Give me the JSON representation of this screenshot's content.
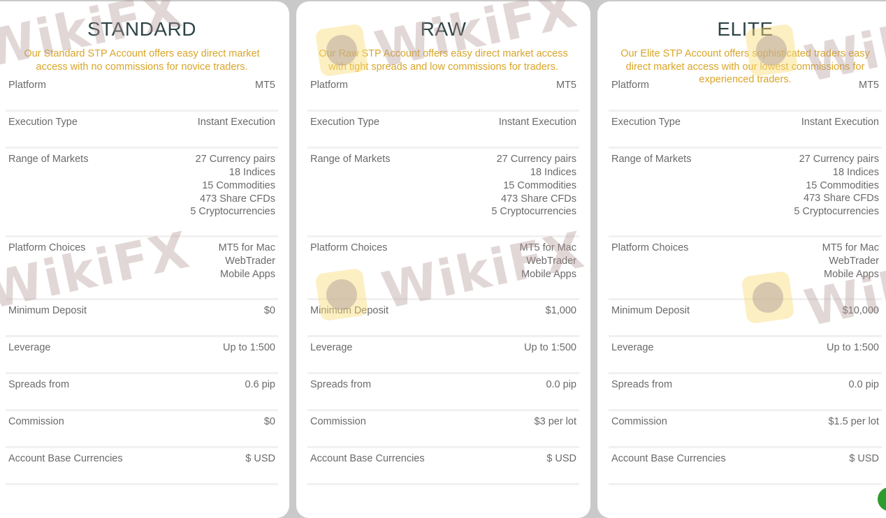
{
  "cards": [
    {
      "title": "STANDARD",
      "description": "Our Standard STP Account offers easy direct market access with no commissions for novice traders.",
      "rows": [
        {
          "label": "Platform",
          "values": [
            "MT5"
          ]
        },
        {
          "label": "Execution Type",
          "values": [
            "Instant Execution"
          ]
        },
        {
          "label": "Range of Markets",
          "values": [
            "27 Currency pairs",
            "18 Indices",
            "15 Commodities",
            "473 Share CFDs",
            "5 Cryptocurrencies"
          ]
        },
        {
          "label": "Platform Choices",
          "values": [
            "MT5 for Mac",
            "WebTrader",
            "Mobile Apps"
          ]
        },
        {
          "label": "Minimum Deposit",
          "values": [
            "$0"
          ]
        },
        {
          "label": "Leverage",
          "values": [
            "Up to 1:500"
          ]
        },
        {
          "label": "Spreads from",
          "values": [
            "0.6 pip"
          ]
        },
        {
          "label": "Commission",
          "values": [
            "$0"
          ]
        },
        {
          "label": "Account Base Currencies",
          "values": [
            "$ USD"
          ]
        }
      ]
    },
    {
      "title": "RAW",
      "description": "Our Raw STP Account offers easy direct market access with tight spreads and low commissions for traders.",
      "rows": [
        {
          "label": "Platform",
          "values": [
            "MT5"
          ]
        },
        {
          "label": "Execution Type",
          "values": [
            "Instant Execution"
          ]
        },
        {
          "label": "Range of Markets",
          "values": [
            "27 Currency pairs",
            "18 Indices",
            "15 Commodities",
            "473 Share CFDs",
            "5 Cryptocurrencies"
          ]
        },
        {
          "label": "Platform Choices",
          "values": [
            "MT5 for Mac",
            "WebTrader",
            "Mobile Apps"
          ]
        },
        {
          "label": "Minimum Deposit",
          "values": [
            "$1,000"
          ]
        },
        {
          "label": "Leverage",
          "values": [
            "Up to 1:500"
          ]
        },
        {
          "label": "Spreads from",
          "values": [
            "0.0 pip"
          ]
        },
        {
          "label": "Commission",
          "values": [
            "$3 per lot"
          ]
        },
        {
          "label": "Account Base Currencies",
          "values": [
            "$ USD"
          ]
        }
      ]
    },
    {
      "title": "ELITE",
      "description": "Our Elite STP Account offers sophisticated traders easy direct market access with our lowest commissions for experienced traders.",
      "rows": [
        {
          "label": "Platform",
          "values": [
            "MT5"
          ]
        },
        {
          "label": "Execution Type",
          "values": [
            "Instant Execution"
          ]
        },
        {
          "label": "Range of Markets",
          "values": [
            "27 Currency pairs",
            "18 Indices",
            "15 Commodities",
            "473 Share CFDs",
            "5 Cryptocurrencies"
          ]
        },
        {
          "label": "Platform Choices",
          "values": [
            "MT5 for Mac",
            "WebTrader",
            "Mobile Apps"
          ]
        },
        {
          "label": "Minimum Deposit",
          "values": [
            "$10,000"
          ]
        },
        {
          "label": "Leverage",
          "values": [
            "Up to 1:500"
          ]
        },
        {
          "label": "Spreads from",
          "values": [
            "0.0 pip"
          ]
        },
        {
          "label": "Commission",
          "values": [
            "$1.5 per lot"
          ]
        },
        {
          "label": "Account Base Currencies",
          "values": [
            "$ USD"
          ]
        }
      ]
    }
  ],
  "watermark": {
    "text": "WikiFX"
  },
  "colors": {
    "title": "#2e4446",
    "description": "#d9a527",
    "row_text": "#6a6a6a",
    "background": "#c9c9c9",
    "chat_widget": "#2e9b2e"
  }
}
